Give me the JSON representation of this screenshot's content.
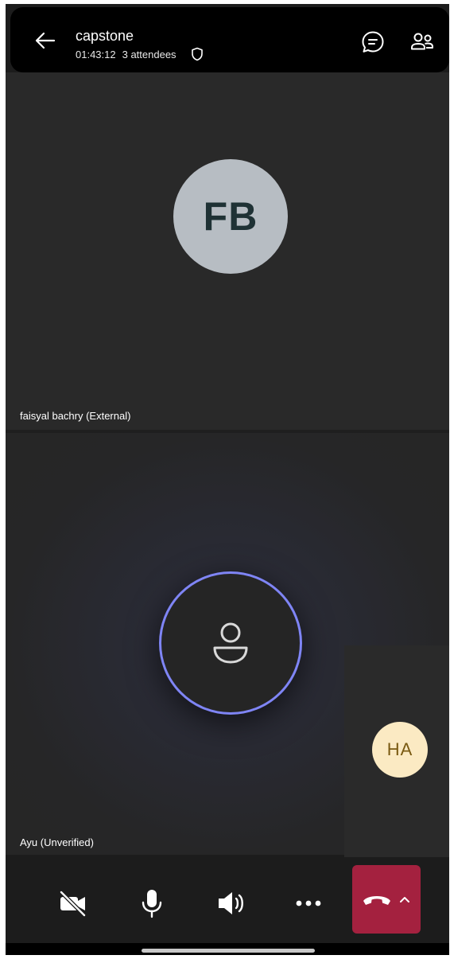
{
  "header": {
    "title": "capstone",
    "duration": "01:43:12",
    "attendees": "3 attendees"
  },
  "participants": [
    {
      "initials": "FB",
      "name": "faisyal bachry (External)"
    },
    {
      "initials": "",
      "name": "Ayu (Unverified)"
    },
    {
      "initials": "HA",
      "name": ""
    }
  ],
  "controls": [
    "camera-off",
    "microphone",
    "speaker",
    "more",
    "hang-up"
  ],
  "colors": {
    "ring": "#7f85f5",
    "hangup": "#a4213f",
    "fb_avatar": "#b7bdc3",
    "ha_avatar": "#fbeac3"
  }
}
